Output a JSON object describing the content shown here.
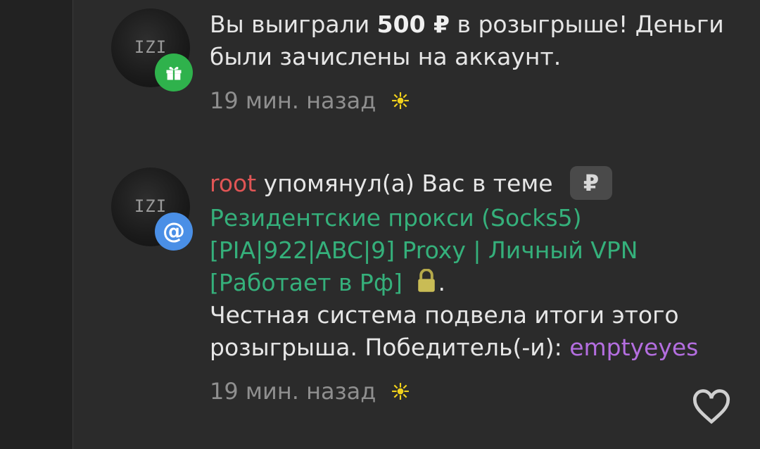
{
  "notifications": [
    {
      "avatar_text": "IZI",
      "badge_icon": "gift-icon",
      "message_prefix": "Вы выиграли ",
      "amount": "500 ₽",
      "message_suffix": " в розыгрыше! Деньги были зачислены на аккаунт.",
      "time": "19 мин. назад"
    },
    {
      "avatar_text": "IZI",
      "badge_icon": "at-sign-icon",
      "badge_char": "@",
      "username": "root",
      "action": " упомянул(а) Вас в теме ",
      "prefix_badge": "₽",
      "thread_title": "Резидентские прокси (Socks5) [PIA|922|ABC|9] Proxy | Личный VPN [Работает в Рф]",
      "after_lock": ".",
      "body_text": "Честная система подвела итоги этого розыгрыша. Победитель(-и): ",
      "winner": "emptyeyes",
      "time": "19 мин. назад"
    }
  ],
  "colors": {
    "background": "#2b2b2b",
    "username": "#e05555",
    "thread_link": "#35b07b",
    "winner": "#b46ee0",
    "gift_badge": "#2fb24c",
    "mention_badge": "#4a8fe6",
    "muted": "#8f8f8f"
  }
}
